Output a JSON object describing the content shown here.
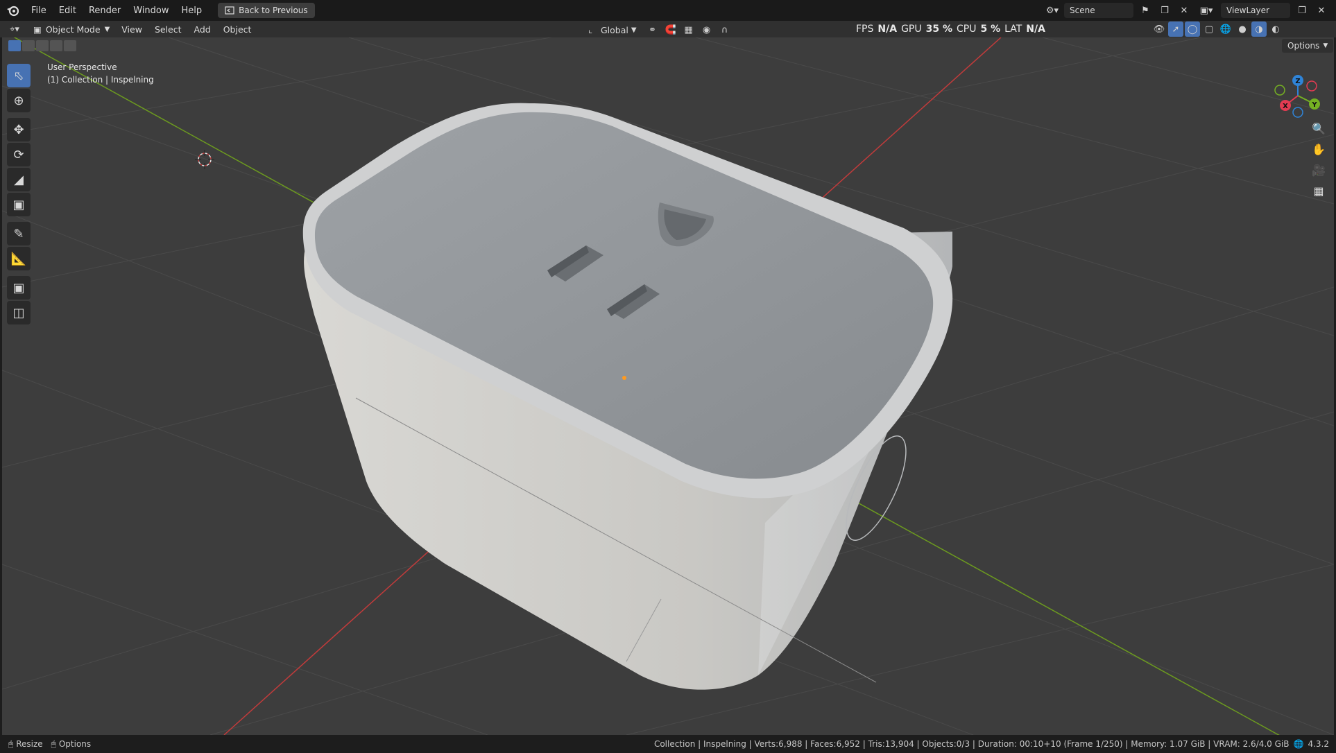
{
  "app": {
    "menus": [
      "File",
      "Edit",
      "Render",
      "Window",
      "Help"
    ],
    "back_button": "Back to Previous",
    "scene": "Scene",
    "view_layer": "ViewLayer"
  },
  "header": {
    "mode": "Object Mode",
    "menus": [
      "View",
      "Select",
      "Add",
      "Object"
    ],
    "transform_orientation": "Global"
  },
  "stats": {
    "fps_label": "FPS",
    "fps_value": "N/A",
    "gpu_label": "GPU",
    "gpu_value": "35 %",
    "cpu_label": "CPU",
    "cpu_value": "5 %",
    "lat_label": "LAT",
    "lat_value": "N/A"
  },
  "viewport": {
    "perspective": "User Perspective",
    "collection_line": "(1) Collection | Inspelning",
    "options": "Options"
  },
  "status": {
    "resize": "Resize",
    "options": "Options",
    "info": "Collection | Inspelning | Verts:6,988 | Faces:6,952 | Tris:13,904 | Objects:0/3 | Duration: 00:10+10 (Frame 1/250) | Memory: 1.07 GiB | VRAM: 2.6/4.0 GiB",
    "version": "4.3.2"
  },
  "colors": {
    "accent": "#4772b3",
    "axis_x": "#c23b3b",
    "axis_y": "#6c9a1f",
    "gizmo_z": "#2f84d8",
    "gizmo_y": "#75b023",
    "gizmo_x": "#e23b52"
  },
  "gizmo": {
    "x": "X",
    "y": "Y",
    "z": "Z"
  }
}
